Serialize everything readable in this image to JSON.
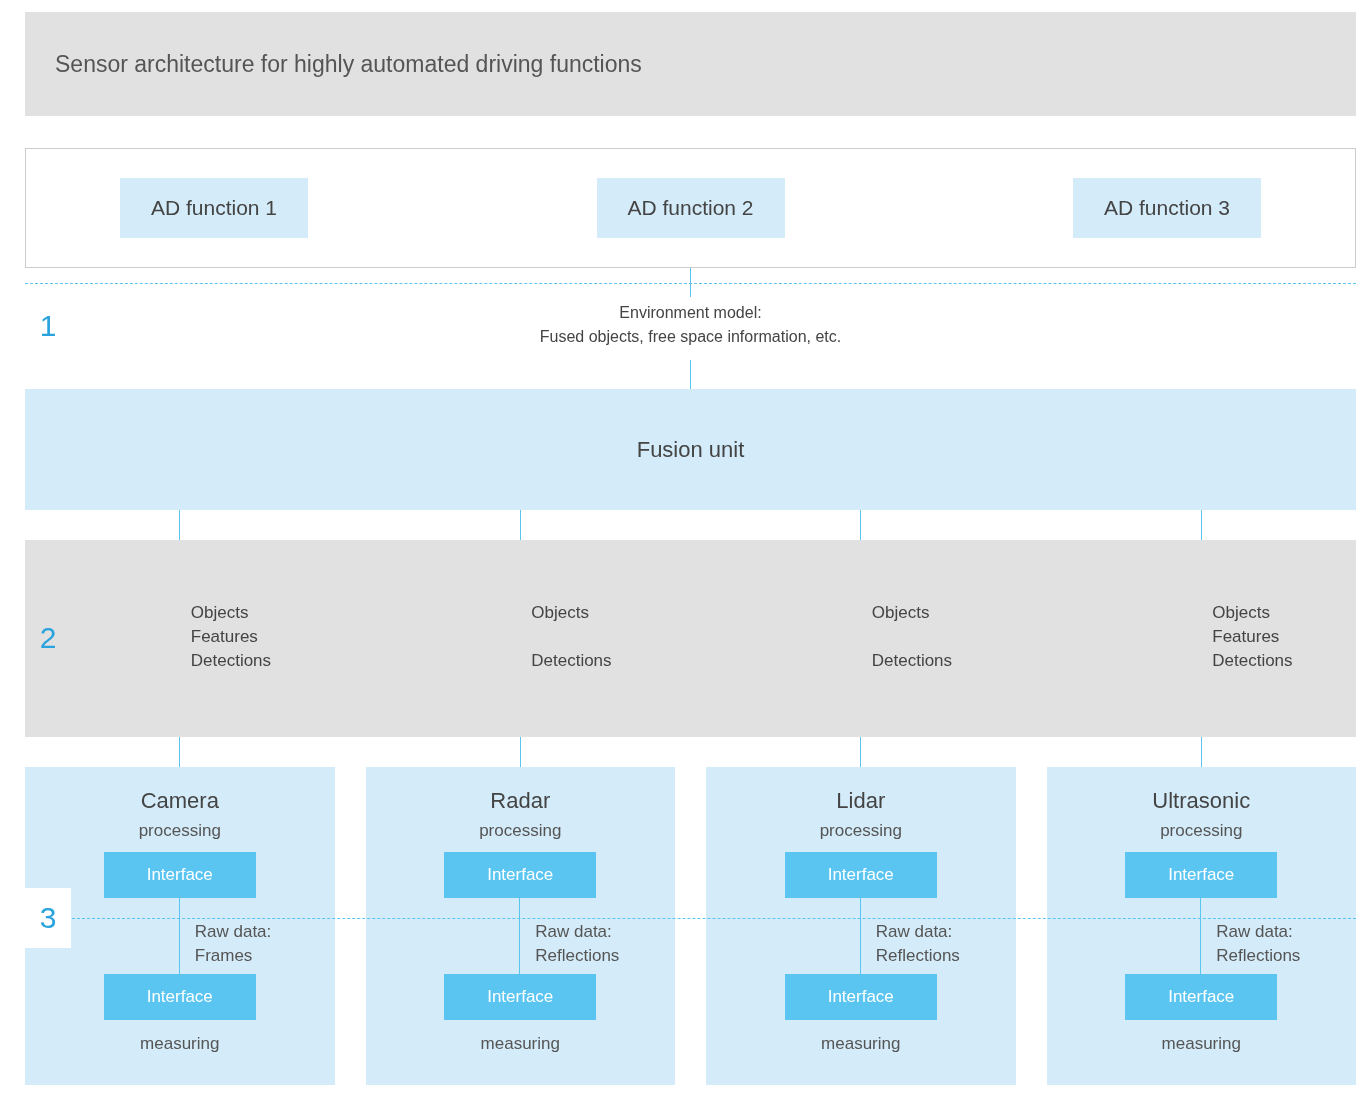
{
  "title": "Sensor architecture for highly automated driving functions",
  "ad_functions": [
    "AD function 1",
    "AD function 2",
    "AD function 3"
  ],
  "layer_numbers": [
    "1",
    "2",
    "3"
  ],
  "environment_model": [
    "Environment model:",
    "Fused objects, free space information, etc."
  ],
  "fusion_unit": "Fusion unit",
  "sensors": [
    {
      "name": "Camera",
      "processing": "processing",
      "outputs": [
        {
          "kind": "objects",
          "text": "Objects"
        },
        {
          "kind": "features",
          "text": "Features"
        },
        {
          "kind": "detections",
          "text": "Detections"
        }
      ],
      "interfaces": [
        "Interface",
        "Interface"
      ],
      "raw_data": [
        "Raw data:",
        "Frames"
      ],
      "measuring": "measuring"
    },
    {
      "name": "Radar",
      "processing": "processing",
      "outputs": [
        {
          "kind": "objects",
          "text": "Objects"
        },
        {
          "kind": "detections",
          "text": "Detections"
        }
      ],
      "interfaces": [
        "Interface",
        "Interface"
      ],
      "raw_data": [
        "Raw data:",
        "Reflections"
      ],
      "measuring": "measuring"
    },
    {
      "name": "Lidar",
      "processing": "processing",
      "outputs": [
        {
          "kind": "objects",
          "text": "Objects"
        },
        {
          "kind": "detections",
          "text": "Detections"
        }
      ],
      "interfaces": [
        "Interface",
        "Interface"
      ],
      "raw_data": [
        "Raw data:",
        "Reflections"
      ],
      "measuring": "measuring"
    },
    {
      "name": "Ultrasonic",
      "processing": "processing",
      "outputs": [
        {
          "kind": "objects",
          "text": "Objects"
        },
        {
          "kind": "features",
          "text": "Features"
        },
        {
          "kind": "detections",
          "text": "Detections"
        }
      ],
      "interfaces": [
        "Interface",
        "Interface"
      ],
      "raw_data": [
        "Raw data:",
        "Reflections"
      ],
      "measuring": "measuring"
    }
  ]
}
